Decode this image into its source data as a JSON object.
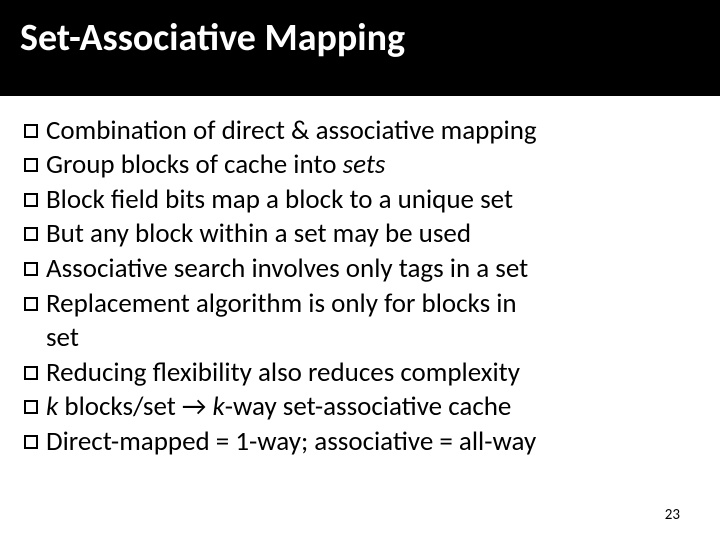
{
  "title": "Set-Associative Mapping",
  "bullets": {
    "b1": "Combination of direct & associative mapping",
    "b2a": "Group blocks of cache into ",
    "b2b": "sets",
    "b3": "Block field bits map a block to a unique set",
    "b4": "But any block within a set may be used",
    "b5": "Associative search involves only tags in a set",
    "b6": "Replacement algorithm is only for blocks in",
    "b6cont": "set",
    "b7": "Reducing flexibility also reduces complexity",
    "b8k": "k",
    "b8a": " blocks/set  →  ",
    "b8b": "k",
    "b8c": "-way set-associative cache",
    "b9": "Direct-mapped = 1-way;  associative = all-way"
  },
  "page_number": "23"
}
